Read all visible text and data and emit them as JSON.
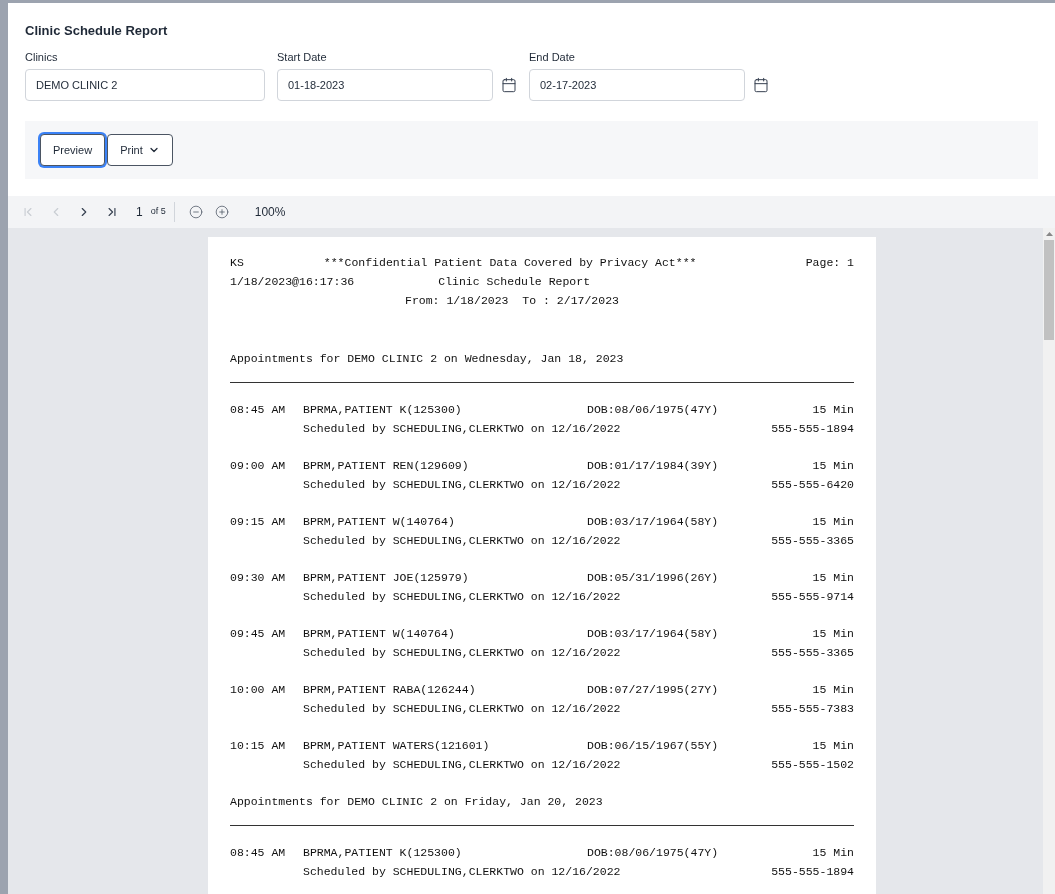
{
  "title": "Clinic Schedule Report",
  "fields": [
    {
      "label": "Clinics",
      "value": "DEMO CLINIC 2",
      "kind": "text"
    },
    {
      "label": "Start Date",
      "value": "01-18-2023",
      "kind": "date"
    },
    {
      "label": "End Date",
      "value": "02-17-2023",
      "kind": "date"
    }
  ],
  "actions": [
    {
      "label": "Preview",
      "kind": "plain",
      "focused": true
    },
    {
      "label": "Print",
      "kind": "dropdown",
      "focused": false
    }
  ],
  "viewer_toolbar": {
    "nav": [
      {
        "kind": "first",
        "disabled": true
      },
      {
        "kind": "prev",
        "disabled": true
      },
      {
        "kind": "next",
        "disabled": false
      },
      {
        "kind": "last",
        "disabled": false
      }
    ],
    "page": "1",
    "page_count": "of 5",
    "zoom": "100%"
  },
  "report": {
    "user": "KS",
    "notice": "***Confidential Patient Data Covered by Privacy Act***",
    "page": "Page: 1",
    "timestamp": "1/18/2023@16:17:36",
    "title": "Clinic Schedule Report",
    "range": "From: 1/18/2023  To : 2/17/2023",
    "sections": [
      {
        "heading": "Appointments for DEMO CLINIC 2 on Wednesday, Jan 18, 2023",
        "appointments": [
          {
            "time": "08:45 AM",
            "patient": "BPRMA,PATIENT K(125300)",
            "dob": "DOB:08/06/1975(47Y)",
            "duration": "15 Min",
            "scheduled": "Scheduled by SCHEDULING,CLERKTWO on 12/16/2022",
            "phone": "555-555-1894"
          },
          {
            "time": "09:00 AM",
            "patient": "BPRM,PATIENT REN(129609)",
            "dob": "DOB:01/17/1984(39Y)",
            "duration": "15 Min",
            "scheduled": "Scheduled by SCHEDULING,CLERKTWO on 12/16/2022",
            "phone": "555-555-6420"
          },
          {
            "time": "09:15 AM",
            "patient": "BPRM,PATIENT W(140764)",
            "dob": "DOB:03/17/1964(58Y)",
            "duration": "15 Min",
            "scheduled": "Scheduled by SCHEDULING,CLERKTWO on 12/16/2022",
            "phone": "555-555-3365"
          },
          {
            "time": "09:30 AM",
            "patient": "BPRM,PATIENT JOE(125979)",
            "dob": "DOB:05/31/1996(26Y)",
            "duration": "15 Min",
            "scheduled": "Scheduled by SCHEDULING,CLERKTWO on 12/16/2022",
            "phone": "555-555-9714"
          },
          {
            "time": "09:45 AM",
            "patient": "BPRM,PATIENT W(140764)",
            "dob": "DOB:03/17/1964(58Y)",
            "duration": "15 Min",
            "scheduled": "Scheduled by SCHEDULING,CLERKTWO on 12/16/2022",
            "phone": "555-555-3365"
          },
          {
            "time": "10:00 AM",
            "patient": "BPRM,PATIENT RABA(126244)",
            "dob": "DOB:07/27/1995(27Y)",
            "duration": "15 Min",
            "scheduled": "Scheduled by SCHEDULING,CLERKTWO on 12/16/2022",
            "phone": "555-555-7383"
          },
          {
            "time": "10:15 AM",
            "patient": "BPRM,PATIENT WATERS(121601)",
            "dob": "DOB:06/15/1967(55Y)",
            "duration": "15 Min",
            "scheduled": "Scheduled by SCHEDULING,CLERKTWO on 12/16/2022",
            "phone": "555-555-1502"
          }
        ]
      },
      {
        "heading": "Appointments for DEMO CLINIC 2 on Friday, Jan 20, 2023",
        "appointments": [
          {
            "time": "08:45 AM",
            "patient": "BPRMA,PATIENT K(125300)",
            "dob": "DOB:08/06/1975(47Y)",
            "duration": "15 Min",
            "scheduled": "Scheduled by SCHEDULING,CLERKTWO on 12/16/2022",
            "phone": "555-555-1894"
          }
        ]
      }
    ]
  }
}
